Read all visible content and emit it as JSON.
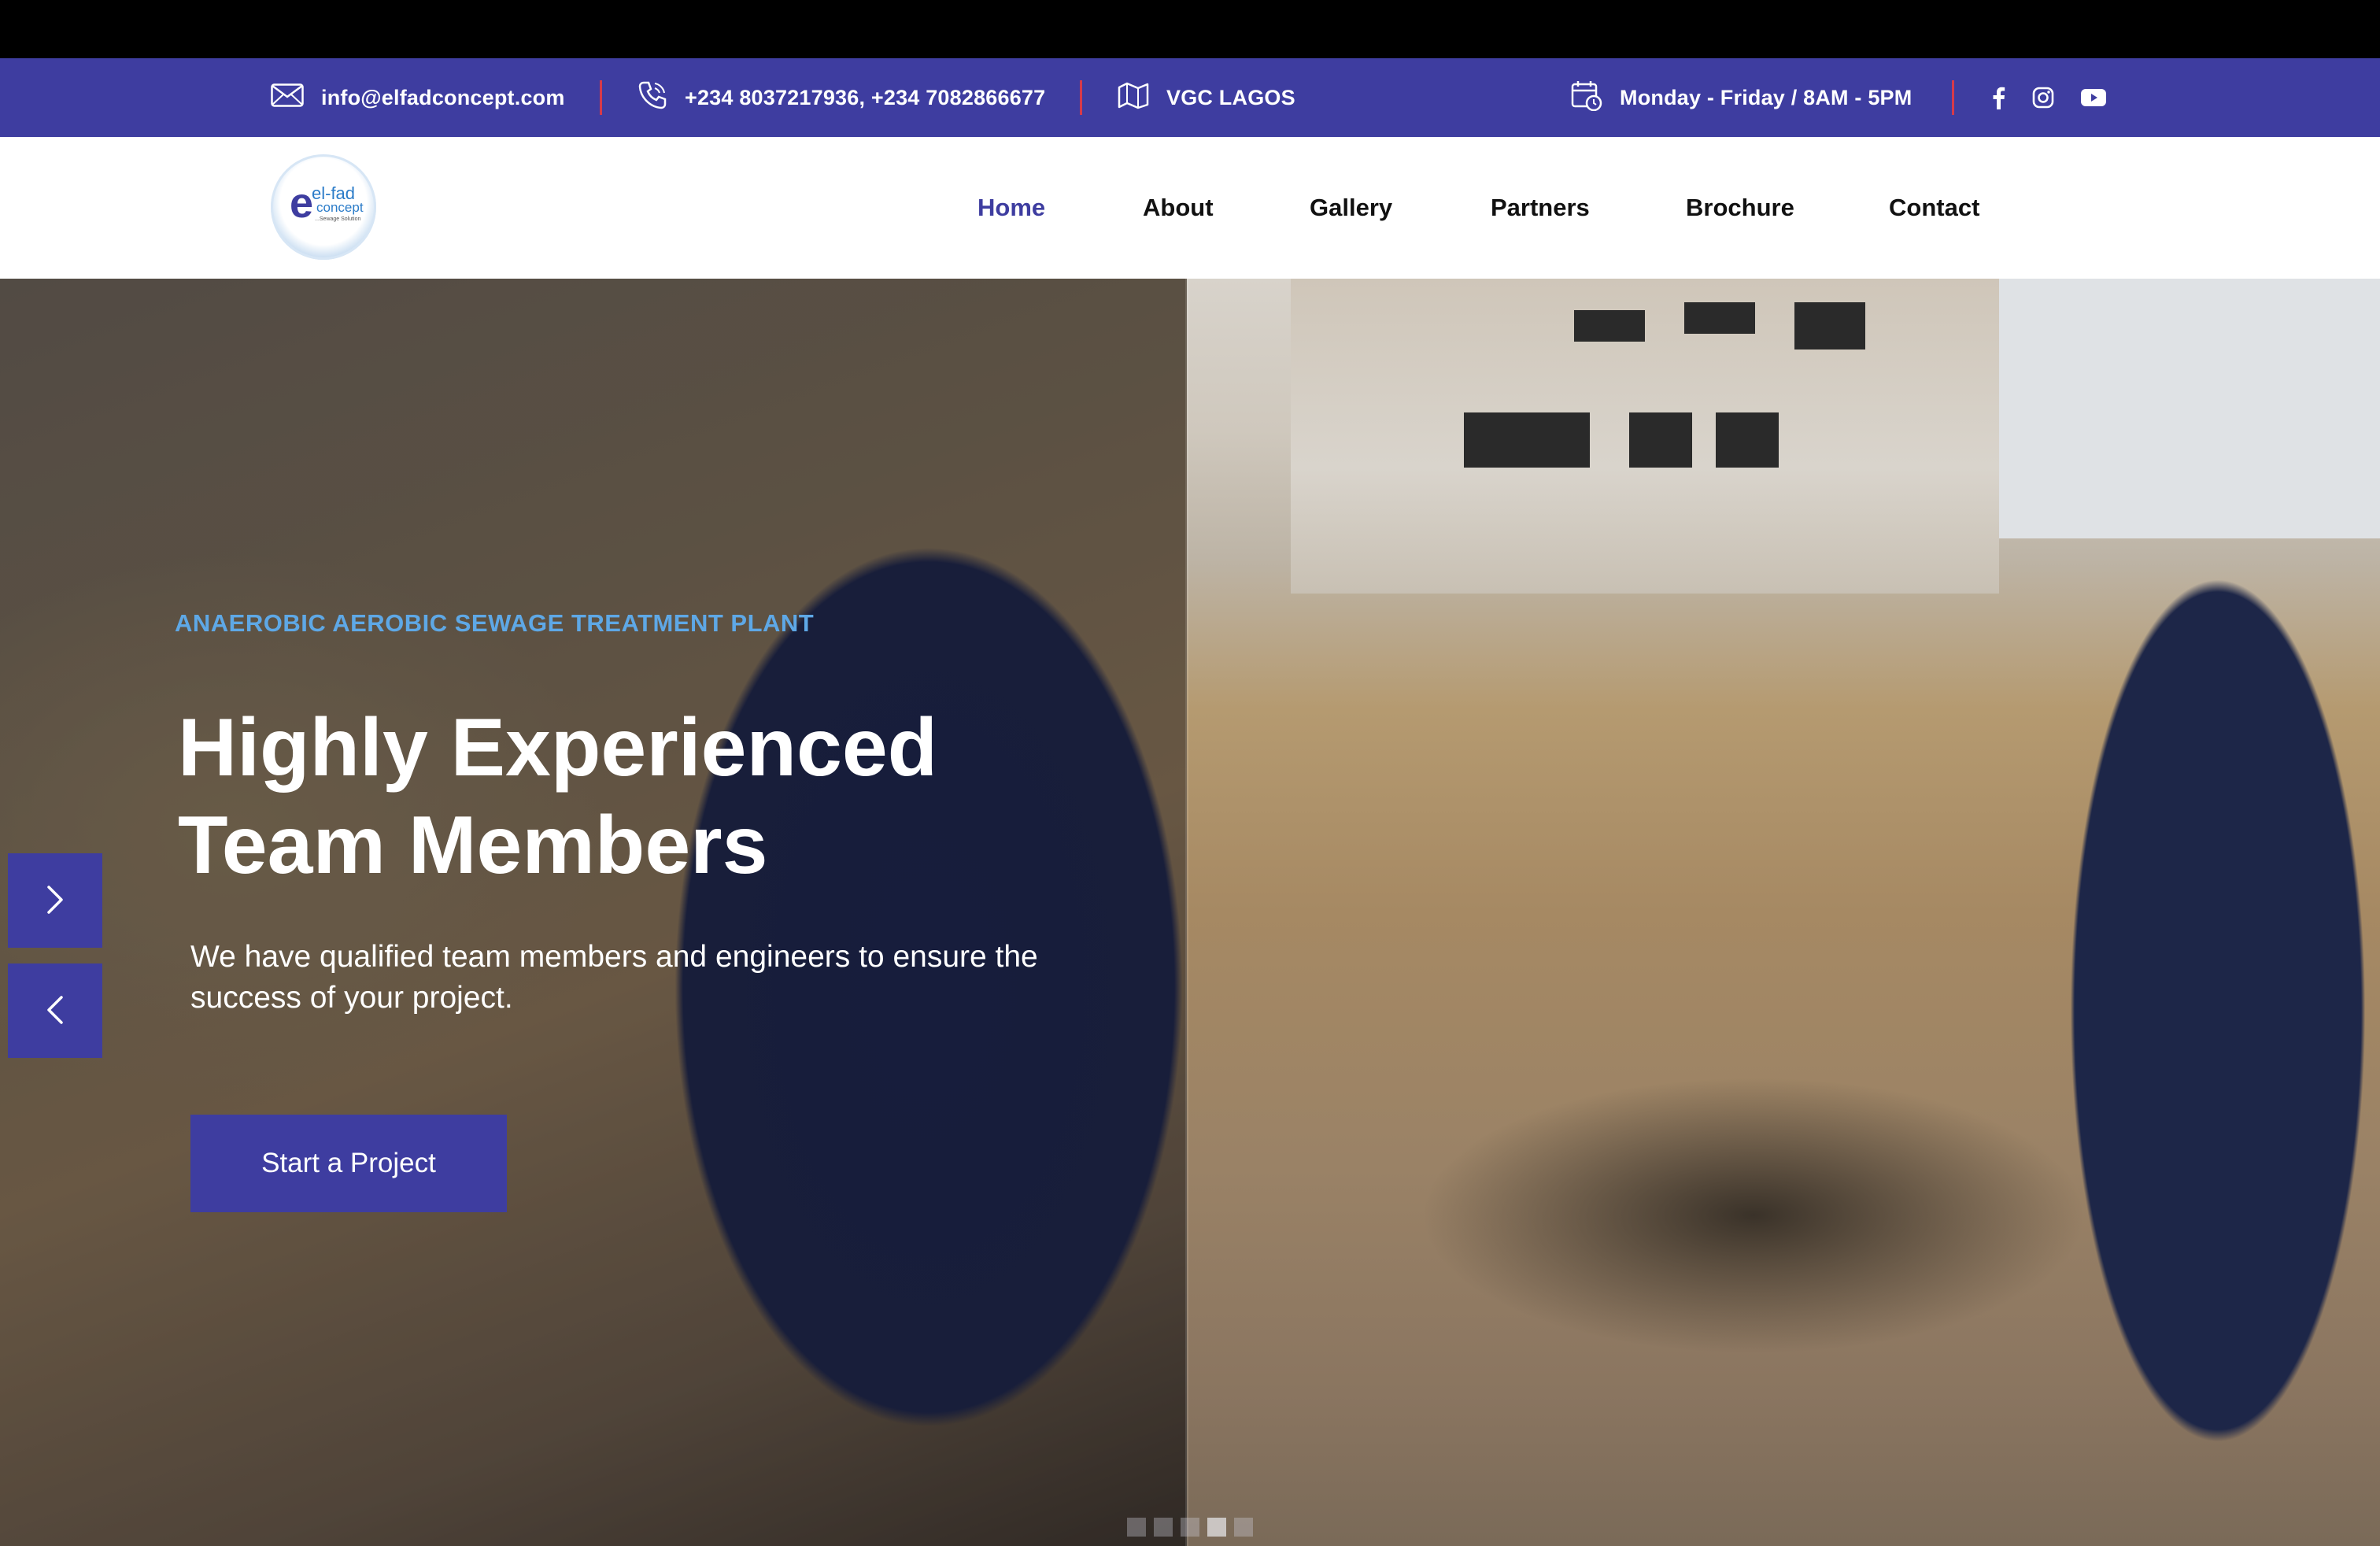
{
  "topbar": {
    "email": "info@elfadconcept.com",
    "phone": "+234 8037217936, +234 7082866677",
    "location": "VGC LAGOS",
    "hours": "Monday - Friday / 8AM - 5PM",
    "icons": {
      "email": "envelope-icon",
      "phone": "phone-icon",
      "location": "map-icon",
      "hours": "calendar-clock-icon",
      "social": [
        "facebook-icon",
        "instagram-icon",
        "youtube-icon"
      ]
    },
    "colors": {
      "background": "#3e3da0",
      "separator": "#d63a4a"
    }
  },
  "header": {
    "logo": {
      "mark": "e",
      "line1": "el-fad",
      "line2": "concept",
      "tagline": "...Sewage Solution"
    },
    "nav": [
      {
        "label": "Home",
        "active": true
      },
      {
        "label": "About"
      },
      {
        "label": "Gallery"
      },
      {
        "label": "Partners"
      },
      {
        "label": "Brochure"
      },
      {
        "label": "Contact"
      }
    ],
    "colors": {
      "active": "#3e3da0",
      "text": "#111111"
    }
  },
  "hero": {
    "eyebrow": "ANAEROBIC AEROBIC SEWAGE TREATMENT PLANT",
    "title_line1": "Highly Experienced",
    "title_line2": "Team Members",
    "subtitle": "We have qualified team members and engineers to ensure the success of your project.",
    "cta_label": "Start a Project",
    "slider": {
      "next_icon": "chevron-right-icon",
      "prev_icon": "chevron-left-icon",
      "total_slides": 5,
      "active_slide": 4
    },
    "colors": {
      "eyebrow": "#5ea8e6",
      "accent": "#3e3da0"
    }
  }
}
